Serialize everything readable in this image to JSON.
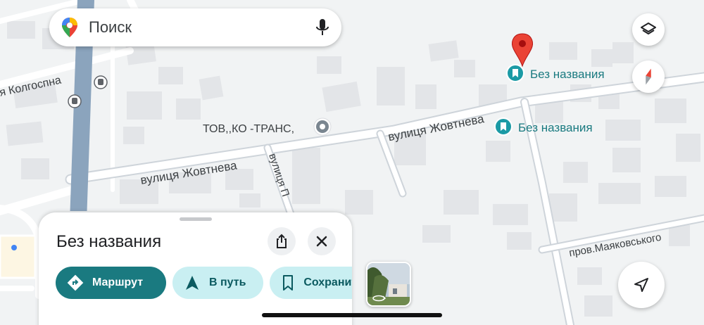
{
  "search": {
    "placeholder": "Поиск",
    "logo_icon": "google-maps-pin-icon",
    "mic_icon": "microphone-icon"
  },
  "map": {
    "street_labels": {
      "kolhospna": "я Колгоспна",
      "zhovtneva_left": "вулиця Жовтнева",
      "zhovtneva_right": "вулиця Жовтнева",
      "vertical_street": "вулиця П",
      "mayakovskoho": "пров.Маяковського"
    },
    "places": {
      "company": "ТОВ,,КО -ТРАНС,",
      "unnamed_selected": "Без названия",
      "unnamed_second": "Без названия"
    },
    "colors": {
      "land": "#f1f3f4",
      "road": "#ffffff",
      "building": "#e3e5e8",
      "major_road": "#8ba4bd",
      "selected_pin": "#ea4335",
      "saved_place": "#1b9aa5"
    }
  },
  "controls": {
    "layers_icon": "layers-icon",
    "compass_icon": "compass-icon",
    "my_location_icon": "navigation-arrow-icon"
  },
  "sheet": {
    "title": "Без названия",
    "share_icon": "share-icon",
    "close_icon": "close-icon",
    "actions": {
      "route_label": "Маршрут",
      "go_label": "В путь",
      "save_label": "Сохранить"
    },
    "accent": "#1a7a80",
    "chip_bg": "#c9eff2"
  },
  "photo": {
    "icon": "360-rotate-icon"
  }
}
